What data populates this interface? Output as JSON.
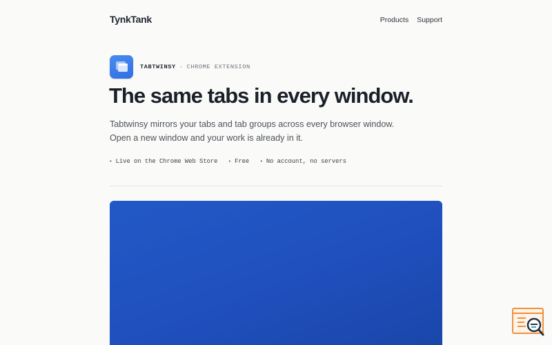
{
  "brand": {
    "logo_text": "TynkTank"
  },
  "nav": {
    "items": [
      {
        "label": "Products"
      },
      {
        "label": "Support"
      }
    ]
  },
  "hero": {
    "icon": "tab-windows-icon",
    "eyebrow_name": "TABTWINSY",
    "eyebrow_separator": "·",
    "eyebrow_category": "CHROME EXTENSION",
    "headline": "The same tabs in every window.",
    "lede_line1": "Tabtwinsy mirrors your tabs and tab groups across every browser window.",
    "lede_line2": "Open a new window and your work is already in it.",
    "features": [
      {
        "marker": "▸",
        "label": "Live on the Chrome Web Store"
      },
      {
        "marker": "▸",
        "label": "Free"
      },
      {
        "marker": "▸",
        "label": "No account, no servers"
      }
    ]
  },
  "colors": {
    "background": "#fafaf8",
    "text": "#1f2530",
    "accent_blue": "#2f6fe3",
    "preview_blue": "#2259c6",
    "widget_orange": "#f0903a"
  },
  "widget": {
    "icon": "search-log-icon"
  }
}
